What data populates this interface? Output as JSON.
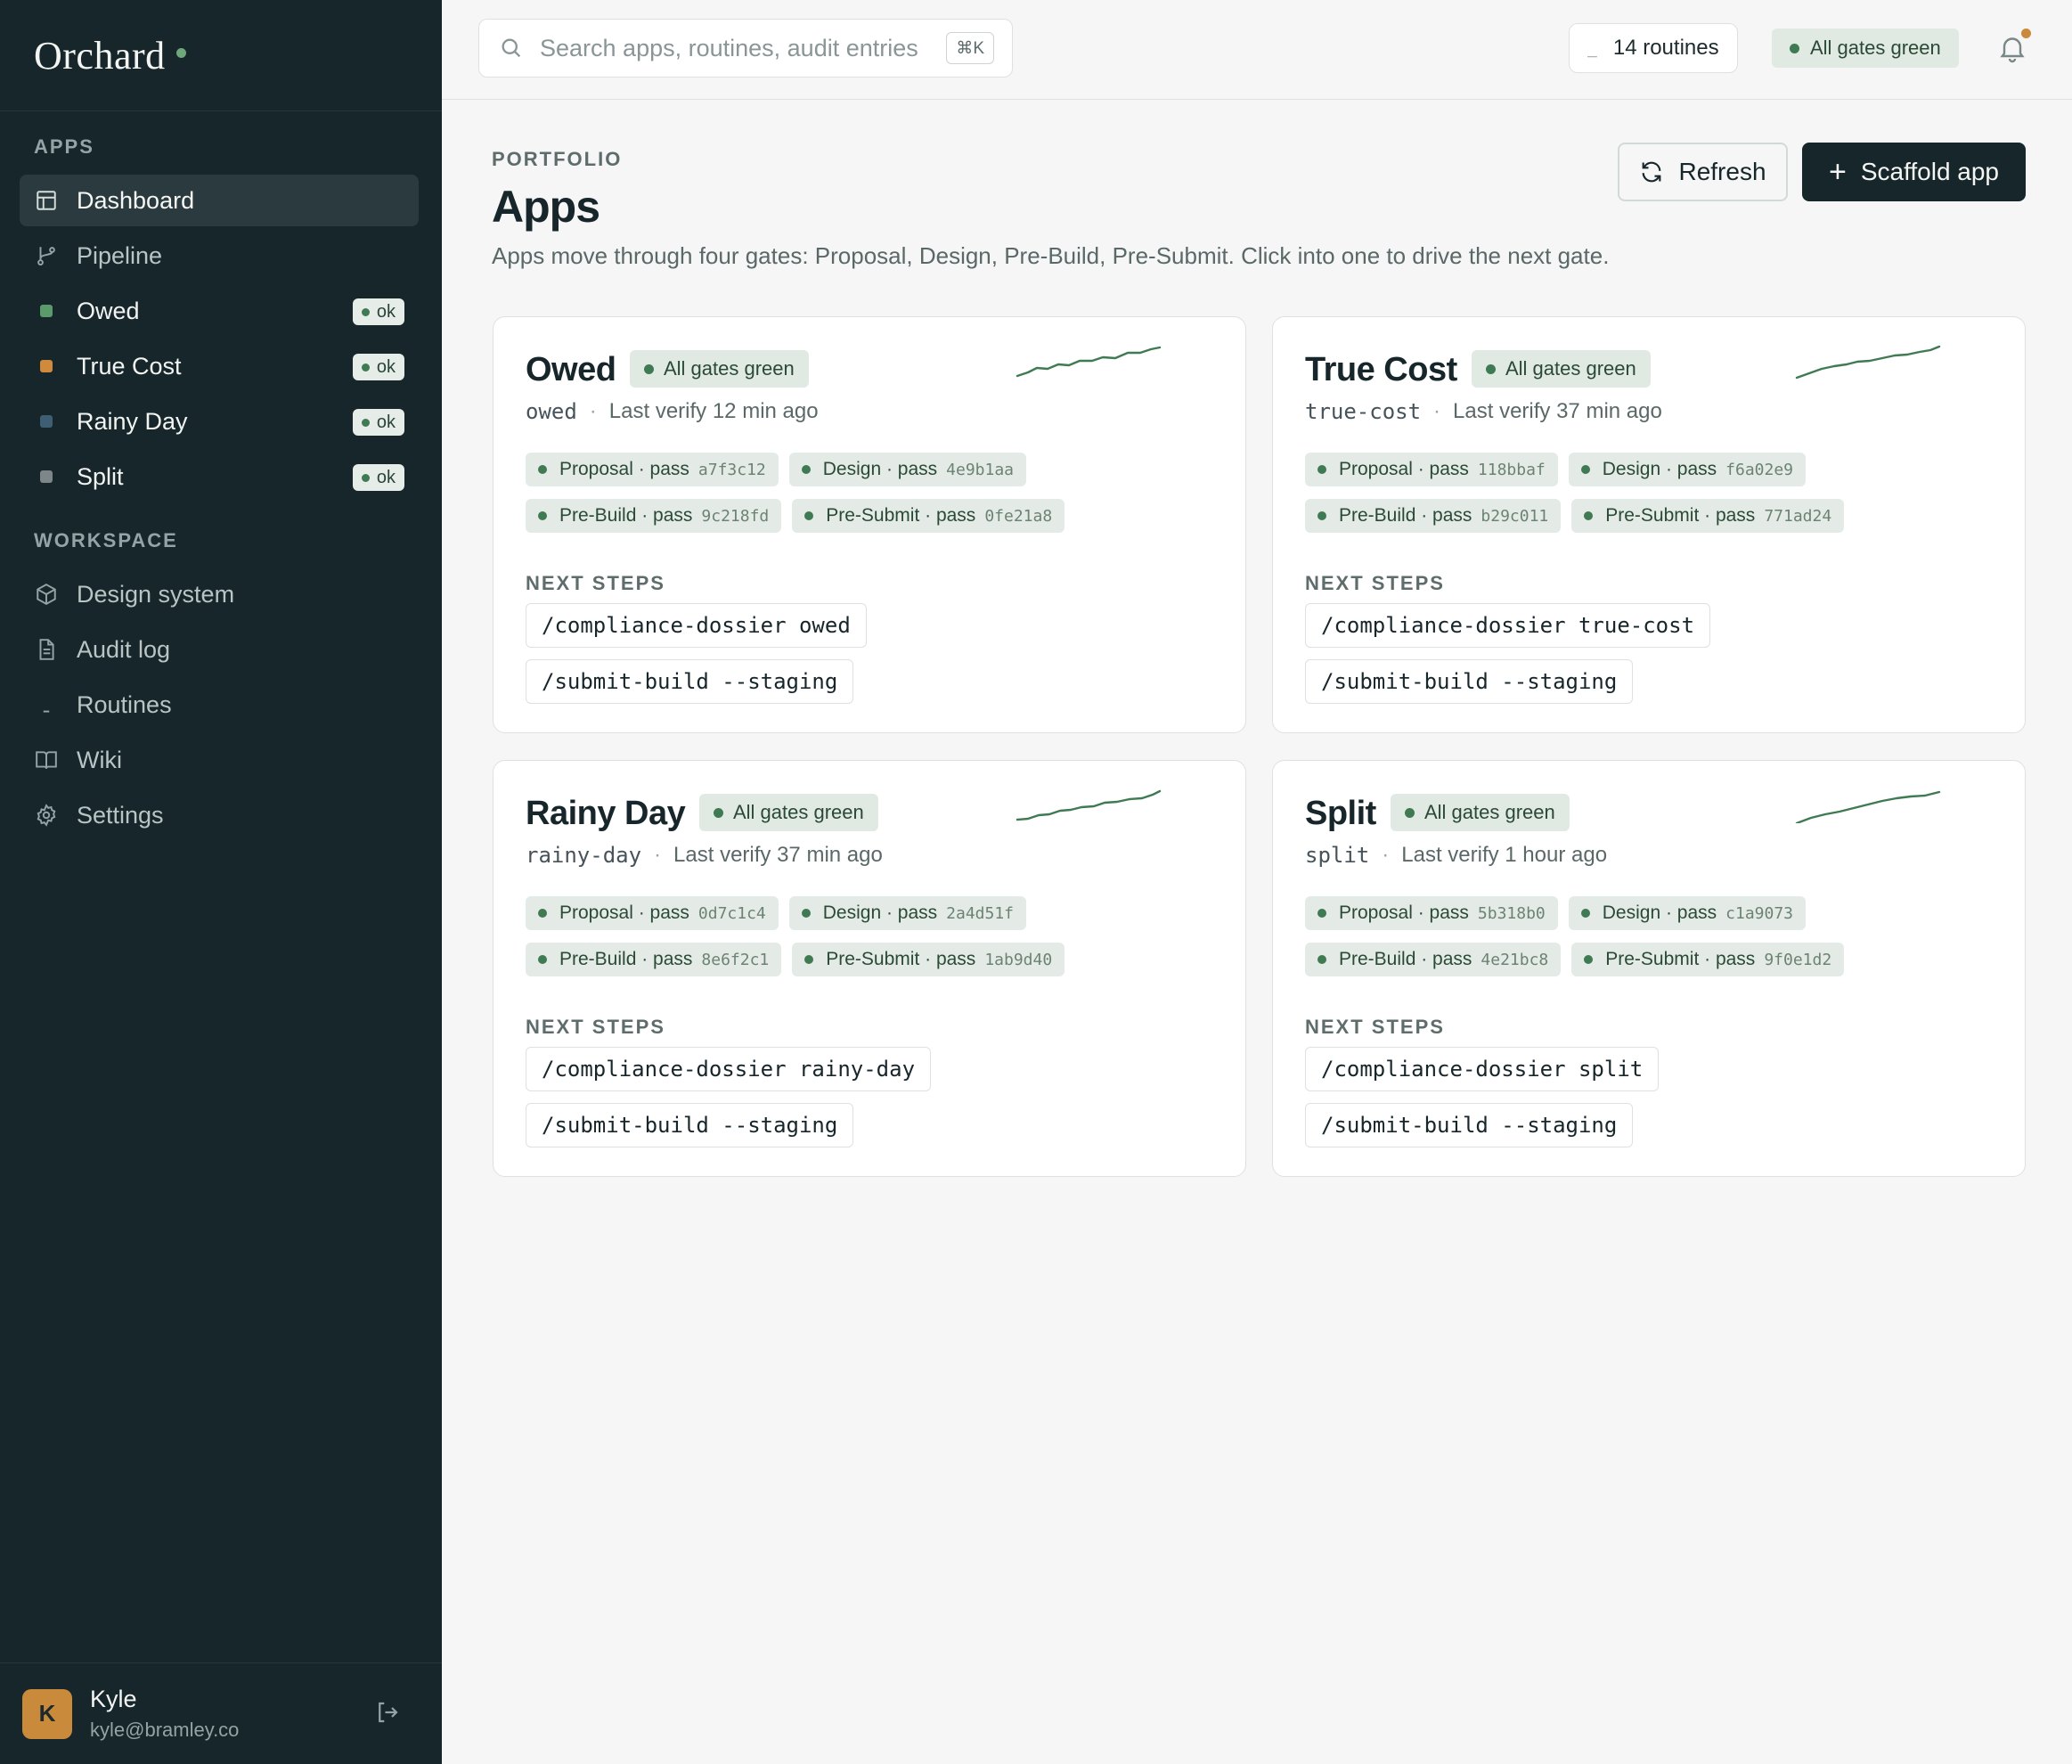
{
  "brand": {
    "name": "Orchard"
  },
  "sidebar": {
    "apps_label": "APPS",
    "workspace_label": "WORKSPACE",
    "primary": [
      {
        "label": "Dashboard",
        "icon": "layout-icon"
      },
      {
        "label": "Pipeline",
        "icon": "branch-icon"
      }
    ],
    "apps": [
      {
        "label": "Owed",
        "color": "#5a9a6b",
        "status": "ok"
      },
      {
        "label": "True Cost",
        "color": "#d08a3b",
        "status": "ok"
      },
      {
        "label": "Rainy Day",
        "color": "#3e5e73",
        "status": "ok"
      },
      {
        "label": "Split",
        "color": "#7d8688",
        "status": "ok"
      }
    ],
    "workspace": [
      {
        "label": "Design system",
        "icon": "cube-icon"
      },
      {
        "label": "Audit log",
        "icon": "document-icon"
      },
      {
        "label": "Routines",
        "icon": "terminal-icon"
      },
      {
        "label": "Wiki",
        "icon": "book-icon"
      },
      {
        "label": "Settings",
        "icon": "gear-icon"
      }
    ]
  },
  "user": {
    "initial": "K",
    "name": "Kyle",
    "email": "kyle@bramley.co"
  },
  "topbar": {
    "search_placeholder": "Search apps, routines, audit entries",
    "shortcut": "⌘K",
    "routines": "14 routines",
    "status": "All gates green"
  },
  "header": {
    "eyebrow": "PORTFOLIO",
    "title": "Apps",
    "description": "Apps move through four gates: Proposal, Design, Pre-Build, Pre-Submit. Click into one to drive the next gate.",
    "refresh_label": "Refresh",
    "scaffold_label": "Scaffold app"
  },
  "colors": {
    "accent": "#17262b",
    "pass": "#3f7a52",
    "pass_bg": "#e1e9e3",
    "notify": "#c98a3b"
  },
  "next_steps_label": "NEXT STEPS",
  "cards": [
    {
      "title": "Owed",
      "status": "All gates green",
      "slug": "owed",
      "last_verify": "Last verify 12 min ago",
      "gates": [
        {
          "label": "Proposal · pass",
          "hash": "a7f3c12"
        },
        {
          "label": "Design · pass",
          "hash": "4e9b1aa"
        },
        {
          "label": "Pre-Build · pass",
          "hash": "9c218fd"
        },
        {
          "label": "Pre-Submit · pass",
          "hash": "0fe21a8"
        }
      ],
      "steps": [
        "/compliance-dossier owed",
        "/submit-build --staging"
      ]
    },
    {
      "title": "True Cost",
      "status": "All gates green",
      "slug": "true-cost",
      "last_verify": "Last verify 37 min ago",
      "gates": [
        {
          "label": "Proposal · pass",
          "hash": "118bbaf"
        },
        {
          "label": "Design · pass",
          "hash": "f6a02e9"
        },
        {
          "label": "Pre-Build · pass",
          "hash": "b29c011"
        },
        {
          "label": "Pre-Submit · pass",
          "hash": "771ad24"
        }
      ],
      "steps": [
        "/compliance-dossier true-cost",
        "/submit-build --staging"
      ]
    },
    {
      "title": "Rainy Day",
      "status": "All gates green",
      "slug": "rainy-day",
      "last_verify": "Last verify 37 min ago",
      "gates": [
        {
          "label": "Proposal · pass",
          "hash": "0d7c1c4"
        },
        {
          "label": "Design · pass",
          "hash": "2a4d51f"
        },
        {
          "label": "Pre-Build · pass",
          "hash": "8e6f2c1"
        },
        {
          "label": "Pre-Submit · pass",
          "hash": "1ab9d40"
        }
      ],
      "steps": [
        "/compliance-dossier rainy-day",
        "/submit-build --staging"
      ]
    },
    {
      "title": "Split",
      "status": "All gates green",
      "slug": "split",
      "last_verify": "Last verify 1 hour ago",
      "gates": [
        {
          "label": "Proposal · pass",
          "hash": "5b318b0"
        },
        {
          "label": "Design · pass",
          "hash": "c1a9073"
        },
        {
          "label": "Pre-Build · pass",
          "hash": "4e21bc8"
        },
        {
          "label": "Pre-Submit · pass",
          "hash": "9f0e1d2"
        }
      ],
      "steps": [
        "/compliance-dossier split",
        "/submit-build --staging"
      ]
    }
  ]
}
